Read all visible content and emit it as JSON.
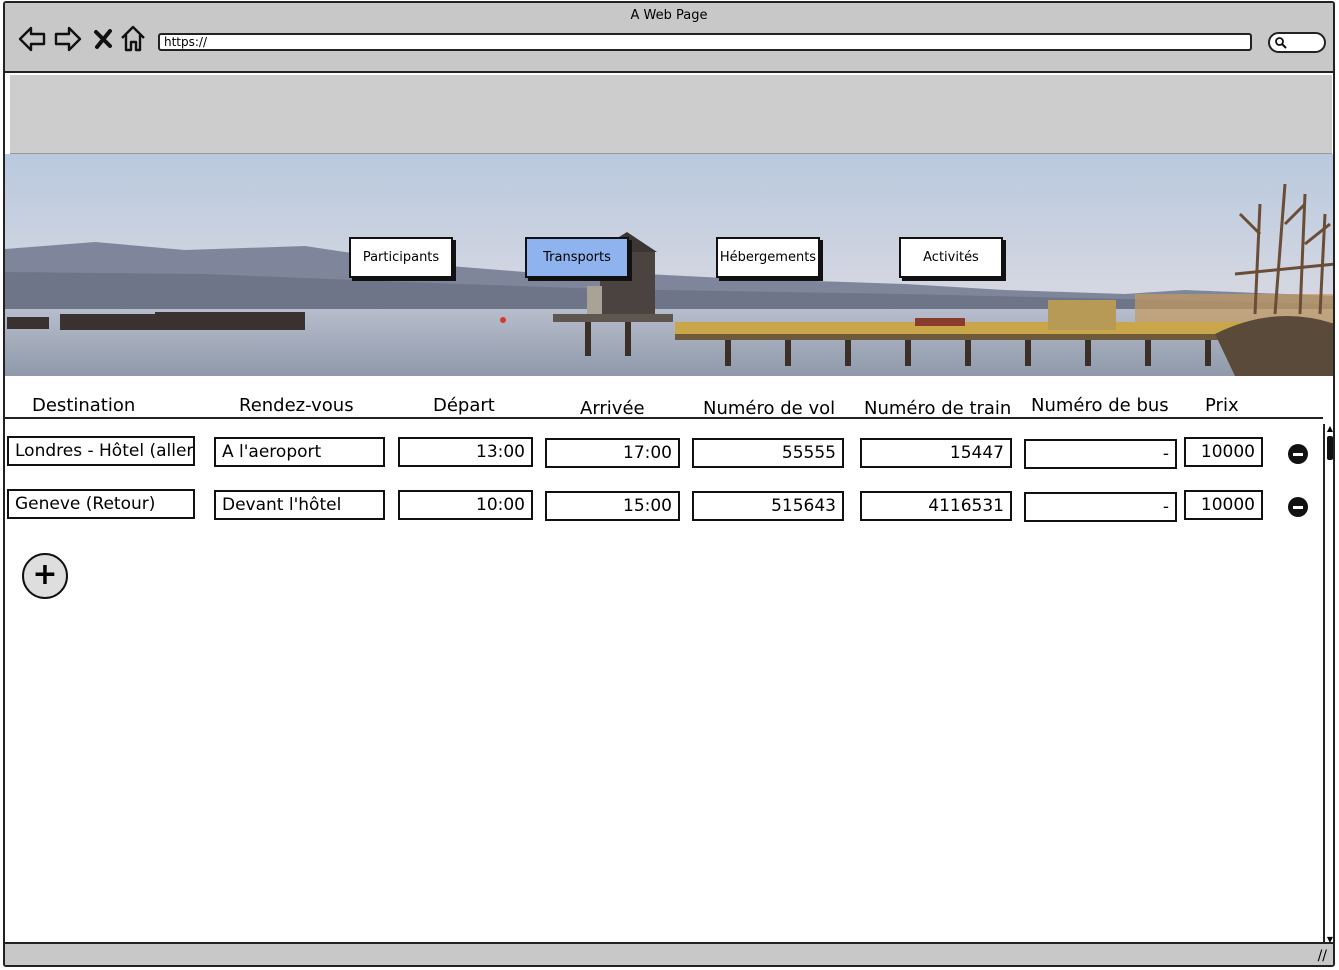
{
  "window": {
    "title": "A Web Page"
  },
  "address_bar": {
    "url": "https://"
  },
  "tabs": [
    {
      "label": "Participants",
      "active": false
    },
    {
      "label": "Transports",
      "active": true
    },
    {
      "label": "Hébergements",
      "active": false
    },
    {
      "label": "Activités",
      "active": false
    }
  ],
  "table": {
    "headers": [
      "Destination",
      "Rendez-vous",
      "Départ",
      "Arrivée",
      "Numéro de vol",
      "Numéro de train",
      "Numéro de bus",
      "Prix"
    ],
    "rows": [
      {
        "destination": "Londres - Hôtel (aller",
        "rendezvous": "A l'aeroport",
        "depart": "13:00",
        "arrivee": "17:00",
        "vol": "55555",
        "train": "15447",
        "bus": "-",
        "prix": "10000"
      },
      {
        "destination": "Geneve (Retour)",
        "rendezvous": "Devant l'hôtel",
        "depart": "10:00",
        "arrivee": "15:00",
        "vol": "515643",
        "train": "4116531",
        "bus": "-",
        "prix": "10000"
      }
    ]
  },
  "actions": {
    "add_icon": "plus-circle-icon",
    "remove_icon": "minus-circle-icon"
  },
  "colors": {
    "active_tab": "#8fb3ef",
    "chrome": "#c8c8c8"
  }
}
